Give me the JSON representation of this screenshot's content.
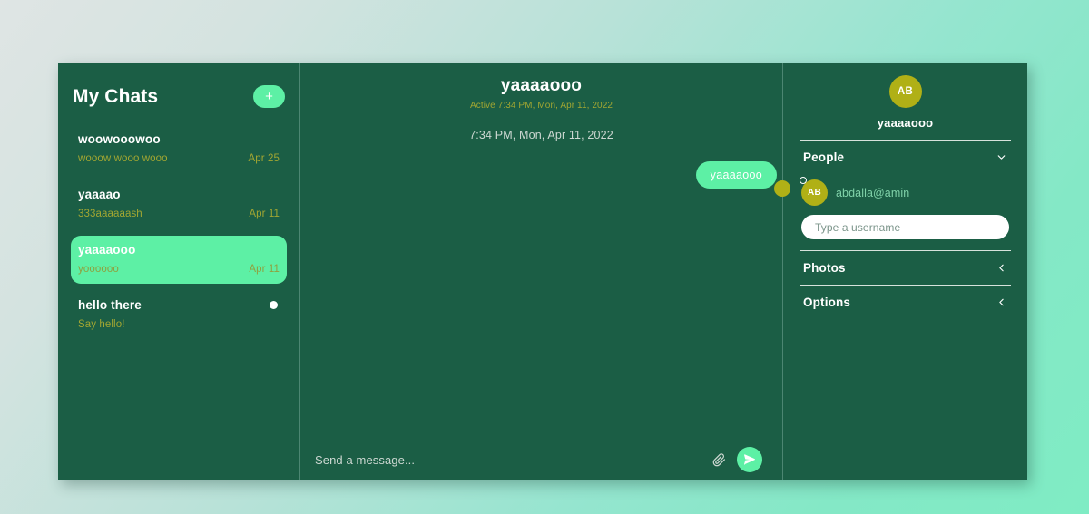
{
  "sidebar": {
    "title": "My Chats",
    "add_button_label": "+",
    "chats": [
      {
        "name": "woowooowoo",
        "preview": "wooow wooo wooo",
        "date": "Apr 25",
        "selected": false,
        "unread": false
      },
      {
        "name": "yaaaao",
        "preview": "333aaaaaash",
        "date": "Apr 11",
        "selected": false,
        "unread": false
      },
      {
        "name": "yaaaaooo",
        "preview": "yoooooo",
        "date": "Apr 11",
        "selected": true,
        "unread": false
      },
      {
        "name": "hello there",
        "preview": "Say hello!",
        "date": "",
        "selected": false,
        "unread": true
      }
    ]
  },
  "chat": {
    "title": "yaaaaooo",
    "status": "Active 7:34 PM, Mon, Apr 11, 2022",
    "timestamp": "7:34 PM, Mon, Apr 11, 2022",
    "messages": [
      {
        "text": "yaaaaooo",
        "outgoing": true,
        "avatar_initials": ""
      }
    ],
    "composer": {
      "placeholder": "Send a message...",
      "value": "",
      "attach_icon": "paperclip-icon",
      "send_icon": "send-plane-icon"
    }
  },
  "info": {
    "avatar_initials": "AB",
    "name": "yaaaaooo",
    "sections": [
      {
        "label": "People",
        "state": "expanded",
        "chevron": "chevron-down-icon"
      },
      {
        "label": "Photos",
        "state": "collapsed",
        "chevron": "chevron-left-icon"
      },
      {
        "label": "Options",
        "state": "collapsed",
        "chevron": "chevron-left-icon"
      }
    ],
    "people": [
      {
        "initials": "AB",
        "username": "abdalla@amin",
        "online": true
      }
    ],
    "username_input": {
      "placeholder": "Type a username",
      "value": ""
    }
  },
  "colors": {
    "panel_bg": "#1b5e45",
    "accent_green": "#5df0a5",
    "olive": "#a2a632",
    "gold_avatar": "#b0b016",
    "divider": "#4c8672"
  }
}
